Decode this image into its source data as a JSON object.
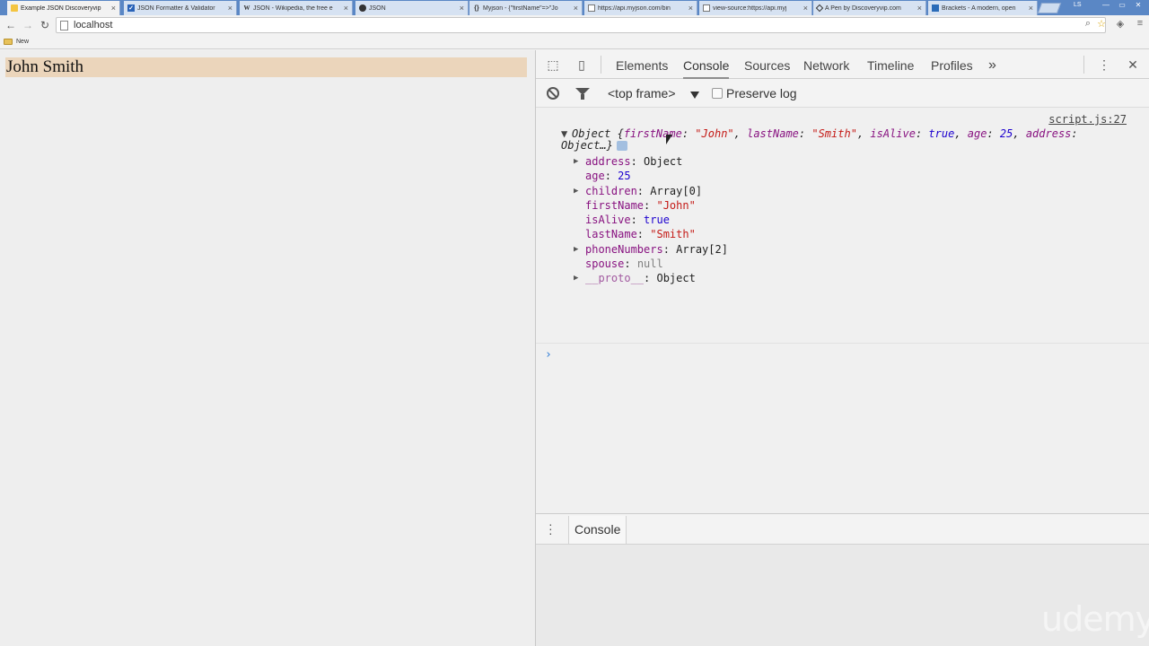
{
  "browser": {
    "tabs": [
      {
        "title": "Example JSON Discoveryvip",
        "icon": "html-icon",
        "active": true
      },
      {
        "title": "JSON Formatter & Validator",
        "icon": "check-icon",
        "active": false
      },
      {
        "title": "JSON - Wikipedia, the free e",
        "icon": "wikipedia-icon",
        "active": false
      },
      {
        "title": "JSON",
        "icon": "github-icon",
        "active": false
      },
      {
        "title": "Myjson - {\"firstName\"=>\"Jo",
        "icon": "braces-icon",
        "active": false
      },
      {
        "title": "https://api.myjson.com/bin",
        "icon": "page-icon",
        "active": false
      },
      {
        "title": "view-source:https://api.myj",
        "icon": "page-icon",
        "active": false
      },
      {
        "title": "A Pen by Discoveryvip.com",
        "icon": "codepen-icon",
        "active": false
      },
      {
        "title": "Brackets - A modern, open",
        "icon": "brackets-icon",
        "active": false
      }
    ],
    "user_initials": "LS",
    "address": "localhost",
    "bookmark_folder": "New"
  },
  "page": {
    "heading": "John Smith"
  },
  "devtools": {
    "tabs": [
      "Elements",
      "Console",
      "Sources",
      "Network",
      "Timeline",
      "Profiles"
    ],
    "active_tab": "Console",
    "more_symbol": "»",
    "frame": "<top frame>",
    "preserve_log": "Preserve log",
    "source_link": "script.js:27",
    "summary": {
      "label": "Object",
      "open": " {",
      "first_key": "firstName",
      "first_val": "\"John\"",
      "second_key": "lastName",
      "second_val": "\"Smith\"",
      "third_key": "isAlive",
      "third_val": "true",
      "fourth_key": "age",
      "fourth_val": "25",
      "fifth_key": "address",
      "tail": "Object…}"
    },
    "properties": [
      {
        "key": "address",
        "value": "Object",
        "expandable": true,
        "kind": "obj"
      },
      {
        "key": "age",
        "value": "25",
        "expandable": false,
        "kind": "num"
      },
      {
        "key": "children",
        "value": "Array[0]",
        "expandable": true,
        "kind": "obj"
      },
      {
        "key": "firstName",
        "value": "\"John\"",
        "expandable": false,
        "kind": "str"
      },
      {
        "key": "isAlive",
        "value": "true",
        "expandable": false,
        "kind": "num"
      },
      {
        "key": "lastName",
        "value": "\"Smith\"",
        "expandable": false,
        "kind": "str"
      },
      {
        "key": "phoneNumbers",
        "value": "Array[2]",
        "expandable": true,
        "kind": "obj"
      },
      {
        "key": "spouse",
        "value": "null",
        "expandable": false,
        "kind": "null"
      },
      {
        "key": "__proto__",
        "value": "Object",
        "expandable": true,
        "kind": "obj"
      }
    ],
    "prompt_symbol": "›",
    "drawer_tab": "Console"
  },
  "watermark": "udemy",
  "colors": {
    "tabstrip": "#5a87c5",
    "heading_bg": "#ebd5bb",
    "key_color": "#881280",
    "string_color": "#c41a16",
    "number_color": "#1c00cf"
  }
}
